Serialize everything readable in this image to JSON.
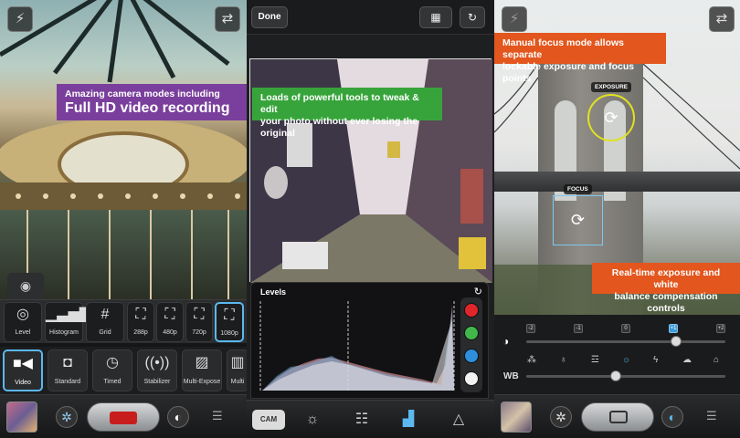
{
  "panel1": {
    "banner_line1": "Amazing camera modes including",
    "banner_line2": "Full HD video recording",
    "flash_icon": "flash-off-icon",
    "switch_icon": "camera-switch-icon",
    "view_icon": "eye-icon",
    "overlay_modes": [
      {
        "label": "Level",
        "icon": "level-icon"
      },
      {
        "label": "Histogram",
        "icon": "histogram-icon"
      },
      {
        "label": "Grid",
        "icon": "grid-icon"
      },
      {
        "label": "288p",
        "icon": "resolution-icon"
      },
      {
        "label": "480p",
        "icon": "resolution-icon"
      },
      {
        "label": "720p",
        "icon": "resolution-icon"
      },
      {
        "label": "1080p",
        "icon": "resolution-icon",
        "selected": true
      }
    ],
    "shoot_modes": [
      {
        "label": "Video",
        "icon": "video-camera-icon",
        "selected": true
      },
      {
        "label": "Standard",
        "icon": "camera-icon"
      },
      {
        "label": "Timed",
        "icon": "timer-icon"
      },
      {
        "label": "Stabilizer",
        "icon": "stabilizer-icon"
      },
      {
        "label": "Multi-Expose",
        "icon": "multi-expose-icon"
      },
      {
        "label": "Multi",
        "icon": "multi-icon"
      }
    ]
  },
  "panel2": {
    "done_label": "Done",
    "banner_line1": "Loads of powerful tools to tweak & edit",
    "banner_line2": "your photo without ever losing the original",
    "levels_title": "Levels",
    "cam_label": "CAM",
    "channel_colors": [
      "#e0262b",
      "#41b64a",
      "#2e8fdc",
      "#f2f2f2"
    ]
  },
  "panel3": {
    "banner1_line1": "Manual focus mode allows separate",
    "banner1_line2": "lockable exposure and focus points",
    "banner2_line1": "Real-time exposure and white",
    "banner2_line2": "balance compensation controls",
    "exposure_tag": "EXPOSURE",
    "focus_tag": "FOCUS",
    "ev_scale": [
      "-2",
      "-1",
      "0",
      "+1",
      "+2"
    ],
    "ev_value": 0.75,
    "wb_label": "WB",
    "wb_value": 0.45
  },
  "colors": {
    "purple_banner": "#7a3f9c",
    "green_banner": "#37a43b",
    "orange_banner": "#e3561d",
    "accent_blue": "#5cb8ef"
  }
}
